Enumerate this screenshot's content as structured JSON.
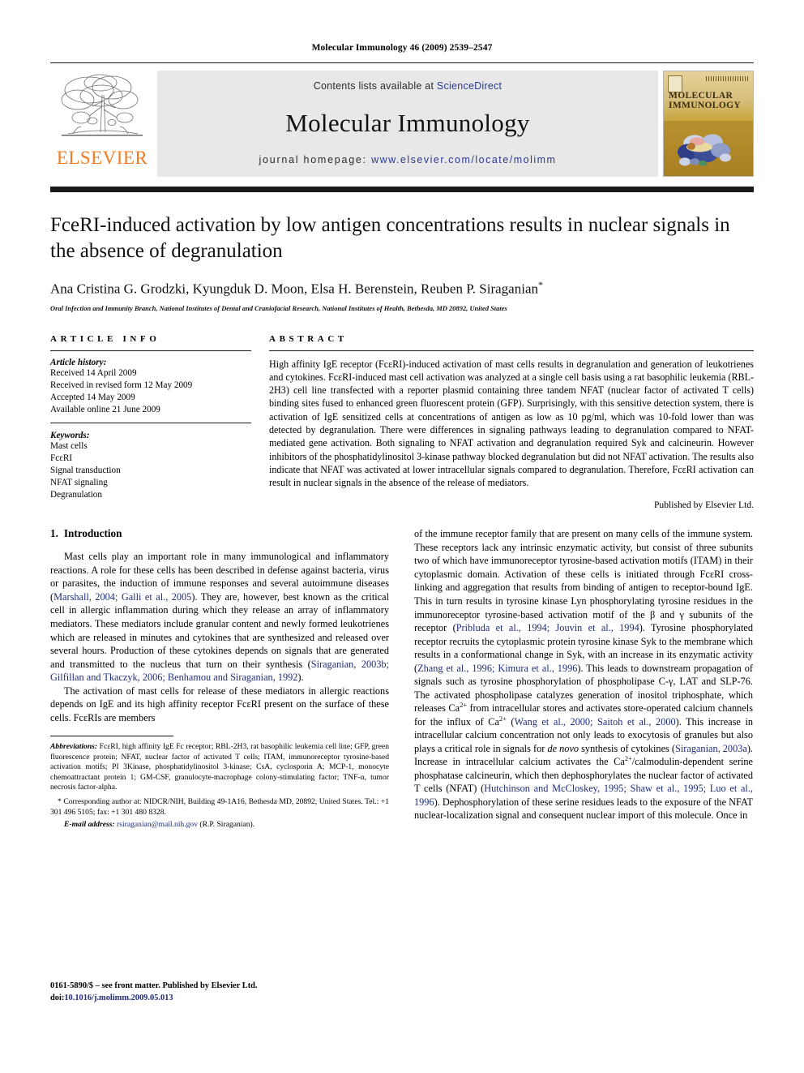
{
  "running_head": "Molecular Immunology 46 (2009) 2539–2547",
  "masthead": {
    "publisher_wordmark": "ELSEVIER",
    "contents_prefix": "Contents lists available at ",
    "sciencedirect": "ScienceDirect",
    "journal_title": "Molecular Immunology",
    "homepage_prefix": "journal homepage:",
    "homepage_url": "www.elsevier.com/locate/molimm",
    "cover_title_line1": "MOLECULAR",
    "cover_title_line2": "IMMUNOLOGY",
    "accent_orange": "#f47b20",
    "link_blue": "#2b3a8f",
    "banner_gray": "#e8e8e8"
  },
  "article": {
    "title": "FceRI-induced activation by low antigen concentrations results in nuclear signals in the absence of degranulation",
    "authors": "Ana Cristina G. Grodzki, Kyungduk D. Moon, Elsa H. Berenstein, Reuben P. Siraganian",
    "corresponding_marker": "*",
    "affiliation": "Oral Infection and Immunity Branch, National Institutes of Dental and Craniofacial Research, National Institutes of Health, Bethesda, MD 20892, United States"
  },
  "article_info": {
    "label": "ARTICLE INFO",
    "history_title": "Article history:",
    "history": [
      "Received 14 April 2009",
      "Received in revised form 12 May 2009",
      "Accepted 14 May 2009",
      "Available online 21 June 2009"
    ],
    "keywords_title": "Keywords:",
    "keywords": [
      "Mast cells",
      "FcεRI",
      "Signal transduction",
      "NFAT signaling",
      "Degranulation"
    ]
  },
  "abstract": {
    "label": "ABSTRACT",
    "text": "High affinity IgE receptor (FcεRI)-induced activation of mast cells results in degranulation and generation of leukotrienes and cytokines. FcεRI-induced mast cell activation was analyzed at a single cell basis using a rat basophilic leukemia (RBL-2H3) cell line transfected with a reporter plasmid containing three tandem NFAT (nuclear factor of activated T cells) binding sites fused to enhanced green fluorescent protein (GFP). Surprisingly, with this sensitive detection system, there is activation of IgE sensitized cells at concentrations of antigen as low as 10 pg/ml, which was 10-fold lower than was detected by degranulation. There were differences in signaling pathways leading to degranulation compared to NFAT-mediated gene activation. Both signaling to NFAT activation and degranulation required Syk and calcineurin. However inhibitors of the phosphatidylinositol 3-kinase pathway blocked degranulation but did not NFAT activation. The results also indicate that NFAT was activated at lower intracellular signals compared to degranulation. Therefore, FcεRI activation can result in nuclear signals in the absence of the release of mediators.",
    "published_by": "Published by Elsevier Ltd."
  },
  "introduction": {
    "number": "1.",
    "heading": "Introduction",
    "p1_a": "Mast cells play an important role in many immunological and inflammatory reactions. A role for these cells has been described in defense against bacteria, virus or parasites, the induction of immune responses and several autoimmune diseases (",
    "p1_cite1": "Marshall, 2004; Galli et al., 2005",
    "p1_b": "). They are, however, best known as the critical cell in allergic inflammation during which they release an array of inflammatory mediators. These mediators include granular content and newly formed leukotrienes which are released in minutes and cytokines that are synthesized and released over several hours. Production of these cytokines depends on signals that are generated and transmitted to the nucleus that turn on their synthesis (",
    "p1_cite2": "Siraganian, 2003b; Gilfillan and Tkaczyk, 2006; Benhamou and Siraganian, 1992",
    "p1_c": ").",
    "p2": "The activation of mast cells for release of these mediators in allergic reactions depends on IgE and its high affinity receptor FcεRI present on the surface of these cells. FcεRIs are members",
    "p2_cont_a": "of the immune receptor family that are present on many cells of the immune system. These receptors lack any intrinsic enzymatic activity, but consist of three subunits two of which have immunoreceptor tyrosine-based activation motifs (ITAM) in their cytoplasmic domain. Activation of these cells is initiated through FcεRI cross-linking and aggregation that results from binding of antigen to receptor-bound IgE. This in turn results in tyrosine kinase Lyn phosphorylating tyrosine residues in the immunoreceptor tyrosine-based activation motif of the β and γ subunits of the receptor (",
    "p2_cite1": "Pribluda et al., 1994; Jouvin et al., 1994",
    "p2_cont_b": "). Tyrosine phosphorylated receptor recruits the cytoplasmic protein tyrosine kinase Syk to the membrane which results in a conformational change in Syk, with an increase in its enzymatic activity (",
    "p2_cite2": "Zhang et al., 1996; Kimura et al., 1996",
    "p2_cont_c": "). This leads to downstream propagation of signals such as tyrosine phosphorylation of phospholipase C-γ, LAT and SLP-76. The activated phospholipase catalyzes generation of inositol triphosphate, which releases Ca",
    "p2_sup1": "2+",
    "p2_cont_d": " from intracellular stores and activates store-operated calcium channels for the influx of Ca",
    "p2_sup2": "2+",
    "p2_cont_e": " (",
    "p2_cite3": "Wang et al., 2000; Saitoh et al., 2000",
    "p2_cont_f": "). This increase in intracellular calcium concentration not only leads to exocytosis of granules but also plays a critical role in signals for ",
    "p2_italic1": "de novo",
    "p2_cont_g": " synthesis of cytokines (",
    "p2_cite4": "Siraganian, 2003a",
    "p2_cont_h": "). Increase in intracellular calcium activates the Ca",
    "p2_sup3": "2+",
    "p2_cont_i": "/calmodulin-dependent serine phosphatase calcineurin, which then dephosphorylates the nuclear factor of activated T cells (NFAT) (",
    "p2_cite5": "Hutchinson and McCloskey, 1995; Shaw et al., 1995; Luo et al., 1996",
    "p2_cont_j": "). Dephosphorylation of these serine residues leads to the exposure of the NFAT nuclear-localization signal and consequent nuclear import of this molecule. Once in"
  },
  "footnote": {
    "abbrev_label": "Abbreviations:",
    "abbrev_text": " FcεRI, high affinity IgE Fc receptor; RBL-2H3, rat basophilic leukemia cell line; GFP, green fluorescence protein; NFAT, nuclear factor of activated T cells; ITAM, immunoreceptor tyrosine-based activation motifs; PI 3Kinase, phosphatidylinositol 3-kinase; CsA, cyclosporin A; MCP-1, monocyte chemoattractant protein 1; GM-CSF, granulocyte-macrophage colony-stimulating factor; TNF-α, tumor necrosis factor-alpha.",
    "corresponding": "* Corresponding author at: NIDCR/NIH, Building 49-1A16, Bethesda MD, 20892, United States. Tel.: +1 301 496 5105; fax: +1 301 480 8328.",
    "email_label": "E-mail address:",
    "email": "rsiraganian@mail.nih.gov",
    "email_suffix": " (R.P. Siraganian)."
  },
  "bottom": {
    "front_matter": "0161-5890/$ – see front matter. Published by Elsevier Ltd.",
    "doi_label": "doi:",
    "doi": "10.1016/j.molimm.2009.05.013"
  }
}
